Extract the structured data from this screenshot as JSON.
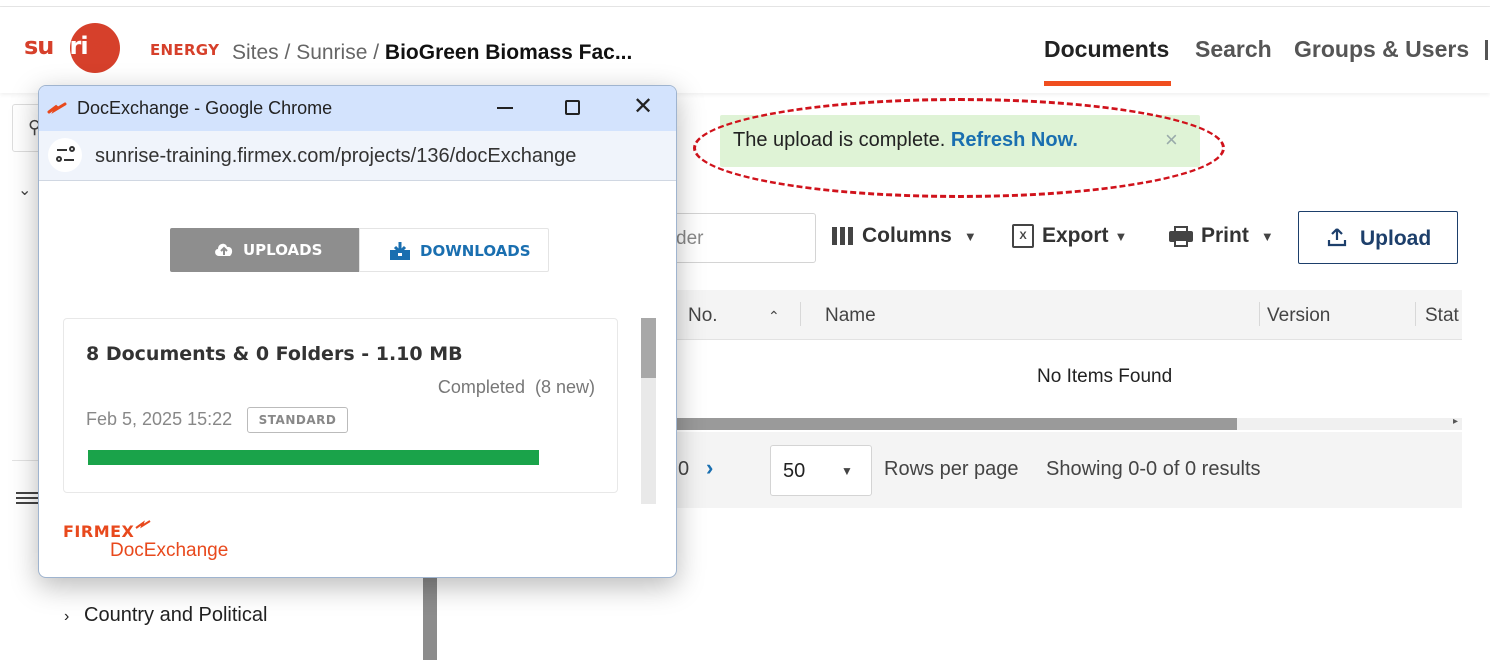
{
  "header": {
    "logo_text": "sunrise",
    "brand_suffix": "ENERGY",
    "breadcrumb_prefix": "Sites / Sunrise / ",
    "breadcrumb_current": "BioGreen Biomass Fac...",
    "nav": [
      "Documents",
      "Search",
      "Groups & Users"
    ],
    "active_nav": "Documents",
    "accent_color": "#f04e1f"
  },
  "sidebar": {
    "country_item": "Country and Political"
  },
  "toast": {
    "message": "The upload is complete.",
    "link": "Refresh Now.",
    "background": "#dff3d6"
  },
  "toolbar": {
    "filter_partial": "der",
    "columns": "Columns",
    "export": "Export",
    "print": "Print",
    "upload": "Upload"
  },
  "table": {
    "headers": [
      "No.",
      "Name",
      "Version",
      "Stat"
    ],
    "empty_text": "No Items Found"
  },
  "pager": {
    "page_partial": "0",
    "rows_per_page_value": "50",
    "rows_label": "Rows per page",
    "showing": "Showing 0-0 of 0 results"
  },
  "popup": {
    "title": "DocExchange - Google Chrome",
    "url": "sunrise-training.firmex.com/projects/136/docExchange",
    "tabs": {
      "uploads": "UPLOADS",
      "downloads": "DOWNLOADS",
      "active": "UPLOADS"
    },
    "card": {
      "title": "8 Documents & 0 Folders - 1.10 MB",
      "status": "Completed",
      "new_count": "(8 new)",
      "date": "Feb 5, 2025 15:22",
      "badge": "STANDARD",
      "progress": 1.0,
      "progress_color": "#1aa34a"
    },
    "footer_logo_top": "FIRMEX",
    "footer_logo_bottom": "DocExchange"
  }
}
